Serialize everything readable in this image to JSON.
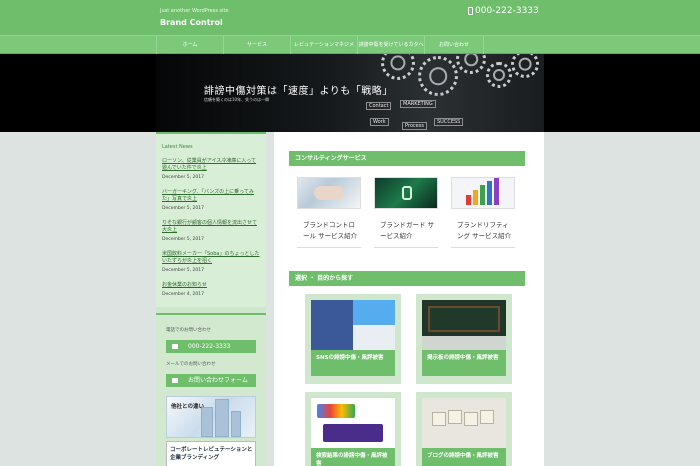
{
  "header": {
    "tagline": "Just another WordPress site",
    "site_title": "Brand Control",
    "phone": "000-222-3333",
    "colors": {
      "brand_green": "#6fbe6c",
      "nav_green": "#7cc97a"
    }
  },
  "nav": {
    "items": [
      {
        "label": "ホーム"
      },
      {
        "label": "サービス"
      },
      {
        "label": "レピュテーションマネジメ"
      },
      {
        "label": "誹謗中傷を受けているカタへ"
      },
      {
        "label": "お問い合わせ"
      }
    ]
  },
  "hero": {
    "title": "誹謗中傷対策は「速度」よりも「戦略」",
    "subtitle": "信頼を築くのは10年、失うのは一瞬",
    "tags": [
      "Contact",
      "Work",
      "MARKETING",
      "Process",
      "SUCCESS"
    ]
  },
  "sidebar": {
    "latest_news_title": "Latest News",
    "news": [
      {
        "title": "ローソン、従業員がアイス冷凍庫に入って遊んでいた件で炎上",
        "date": "December 5, 2017"
      },
      {
        "title": "バーガーキング、「バンズの上に乗ってみた」写真で炎上",
        "date": "December 5, 2017"
      },
      {
        "title": "りそな銀行が顧客の個人情報を流出させて大炎上",
        "date": "December 5, 2017"
      },
      {
        "title": "米国飲料メーカー「Soba」のちょっとしたいたずらが炎上を招く",
        "date": "December 5, 2017"
      },
      {
        "title": "お金休業のお知らせ",
        "date": "December 4, 2017"
      }
    ],
    "phone_label": "電話でのお問い合わせ",
    "phone_button": "000-222-3333",
    "mail_label": "メールでのお問い合わせ",
    "mail_button": "お問い合わせフォーム",
    "banner_1": "他社との違い",
    "banner_2": "コーポレートレピュテーションと企業ブランディング"
  },
  "main": {
    "services_header": "コンサルティングサービス",
    "services": [
      {
        "label": "ブランドコントロール サービス紹介"
      },
      {
        "label": "ブランドガード サービス紹介"
      },
      {
        "label": "ブランドリフティング サービス紹介"
      }
    ],
    "damage_header": "選択 ・ 目的から探す",
    "damage_cards": [
      {
        "caption": "SNSの誹謗中傷・風評被害"
      },
      {
        "caption": "掲示板の誹謗中傷・風評被害"
      },
      {
        "caption": "検索結果の誹謗中傷・風評被害"
      },
      {
        "caption": "ブログの誹謗中傷・風評被害"
      }
    ]
  }
}
